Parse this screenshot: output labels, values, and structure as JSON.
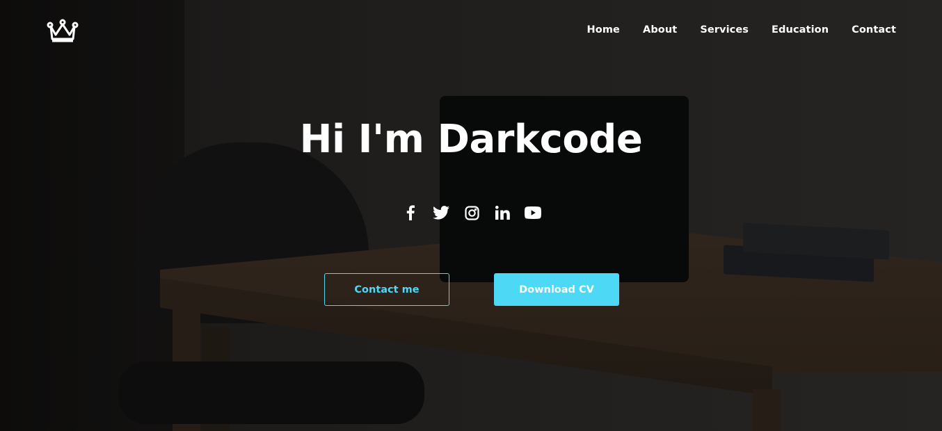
{
  "brand": {
    "logo_icon": "crown-icon"
  },
  "nav": {
    "items": [
      {
        "label": "Home"
      },
      {
        "label": "About"
      },
      {
        "label": "Services"
      },
      {
        "label": "Education"
      },
      {
        "label": "Contact"
      }
    ]
  },
  "hero": {
    "title": "Hi I'm Darkcode",
    "socials": [
      "facebook-icon",
      "twitter-icon",
      "instagram-icon",
      "linkedin-icon",
      "youtube-icon"
    ],
    "primary_button": "Contact me",
    "secondary_button": "Download CV"
  },
  "colors": {
    "accent": "#4dd8f5",
    "text": "#ffffff"
  }
}
